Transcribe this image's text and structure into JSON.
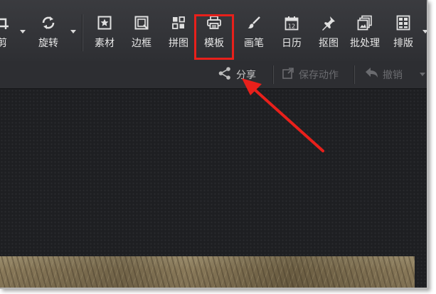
{
  "toolbar": {
    "tools": [
      {
        "id": "crop",
        "label": "剪",
        "icon": "crop-icon"
      },
      {
        "id": "rotate",
        "label": "旋转",
        "icon": "rotate-icon"
      },
      {
        "id": "material",
        "label": "素材",
        "icon": "star-frame-icon"
      },
      {
        "id": "border",
        "label": "边框",
        "icon": "border-icon"
      },
      {
        "id": "collage",
        "label": "拼图",
        "icon": "grid-icon"
      },
      {
        "id": "template",
        "label": "模板",
        "icon": "printer-icon"
      },
      {
        "id": "brush",
        "label": "画笔",
        "icon": "brush-icon"
      },
      {
        "id": "calendar",
        "label": "日历",
        "icon": "calendar-icon",
        "day": "12"
      },
      {
        "id": "cutout",
        "label": "抠图",
        "icon": "pin-icon"
      },
      {
        "id": "batch",
        "label": "批处理",
        "icon": "batch-icon"
      },
      {
        "id": "layout",
        "label": "排版",
        "icon": "layout-icon"
      }
    ]
  },
  "subbar": {
    "share": "分享",
    "save_action": "保存动作",
    "undo": "撤销"
  },
  "colors": {
    "highlight": "#e8201b",
    "toolbar_bg": "#333438",
    "canvas_bg": "#1e1f22",
    "label": "#e8e8e8",
    "disabled": "#6a6b6f"
  }
}
